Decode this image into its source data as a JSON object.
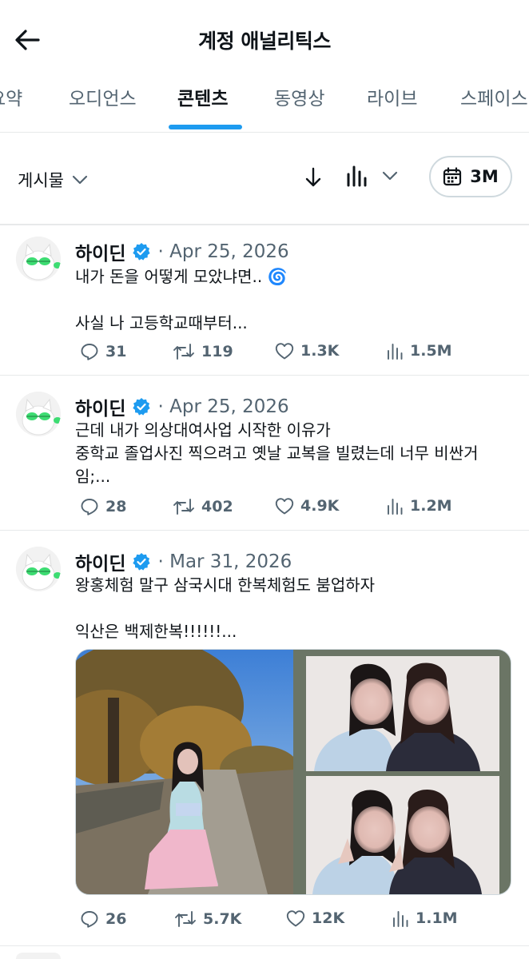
{
  "header": {
    "title": "계정 애널리틱스"
  },
  "tabs": [
    {
      "label": "요약"
    },
    {
      "label": "오디언스"
    },
    {
      "label": "콘텐츠"
    },
    {
      "label": "동영상"
    },
    {
      "label": "라이브"
    },
    {
      "label": "스페이스"
    }
  ],
  "active_tab": "콘텐츠",
  "filter": {
    "type_label": "게시물",
    "range_label": "3M"
  },
  "posts": [
    {
      "name": "하이딘",
      "date": "· Apr 25, 2026",
      "text": "내가 돈을 어떻게 모았냐면.. 🌀\n\n사실 나 고등학교때부터...",
      "replies": "31",
      "reposts": "119",
      "likes": "1.3K",
      "views": "1.5M"
    },
    {
      "name": "하이딘",
      "date": "· Apr 25, 2026",
      "text": "근데 내가 의상대여사업 시작한 이유가\n중학교 졸업사진 찍으려고 옛날 교복을 빌렸는데 너무 비싼거임;...",
      "replies": "28",
      "reposts": "402",
      "likes": "4.9K",
      "views": "1.2M"
    },
    {
      "name": "하이딘",
      "date": "· Mar 31, 2026",
      "text": "왕홍체험 말구 삼국시대 한복체험도 붐업하자\n\n익산은 백제한복!!!!!!...",
      "replies": "26",
      "reposts": "5.7K",
      "likes": "12K",
      "views": "1.1M"
    }
  ],
  "colors": {
    "accent": "#1d9bf0",
    "text": "#0f1419",
    "muted": "#536471",
    "border": "#e7e9ea"
  },
  "icons": [
    "back-arrow-icon",
    "chevron-down-icon",
    "sort-down-icon",
    "bar-chart-icon",
    "calendar-icon",
    "verified-badge-icon",
    "reply-icon",
    "repost-icon",
    "like-icon",
    "views-icon"
  ]
}
